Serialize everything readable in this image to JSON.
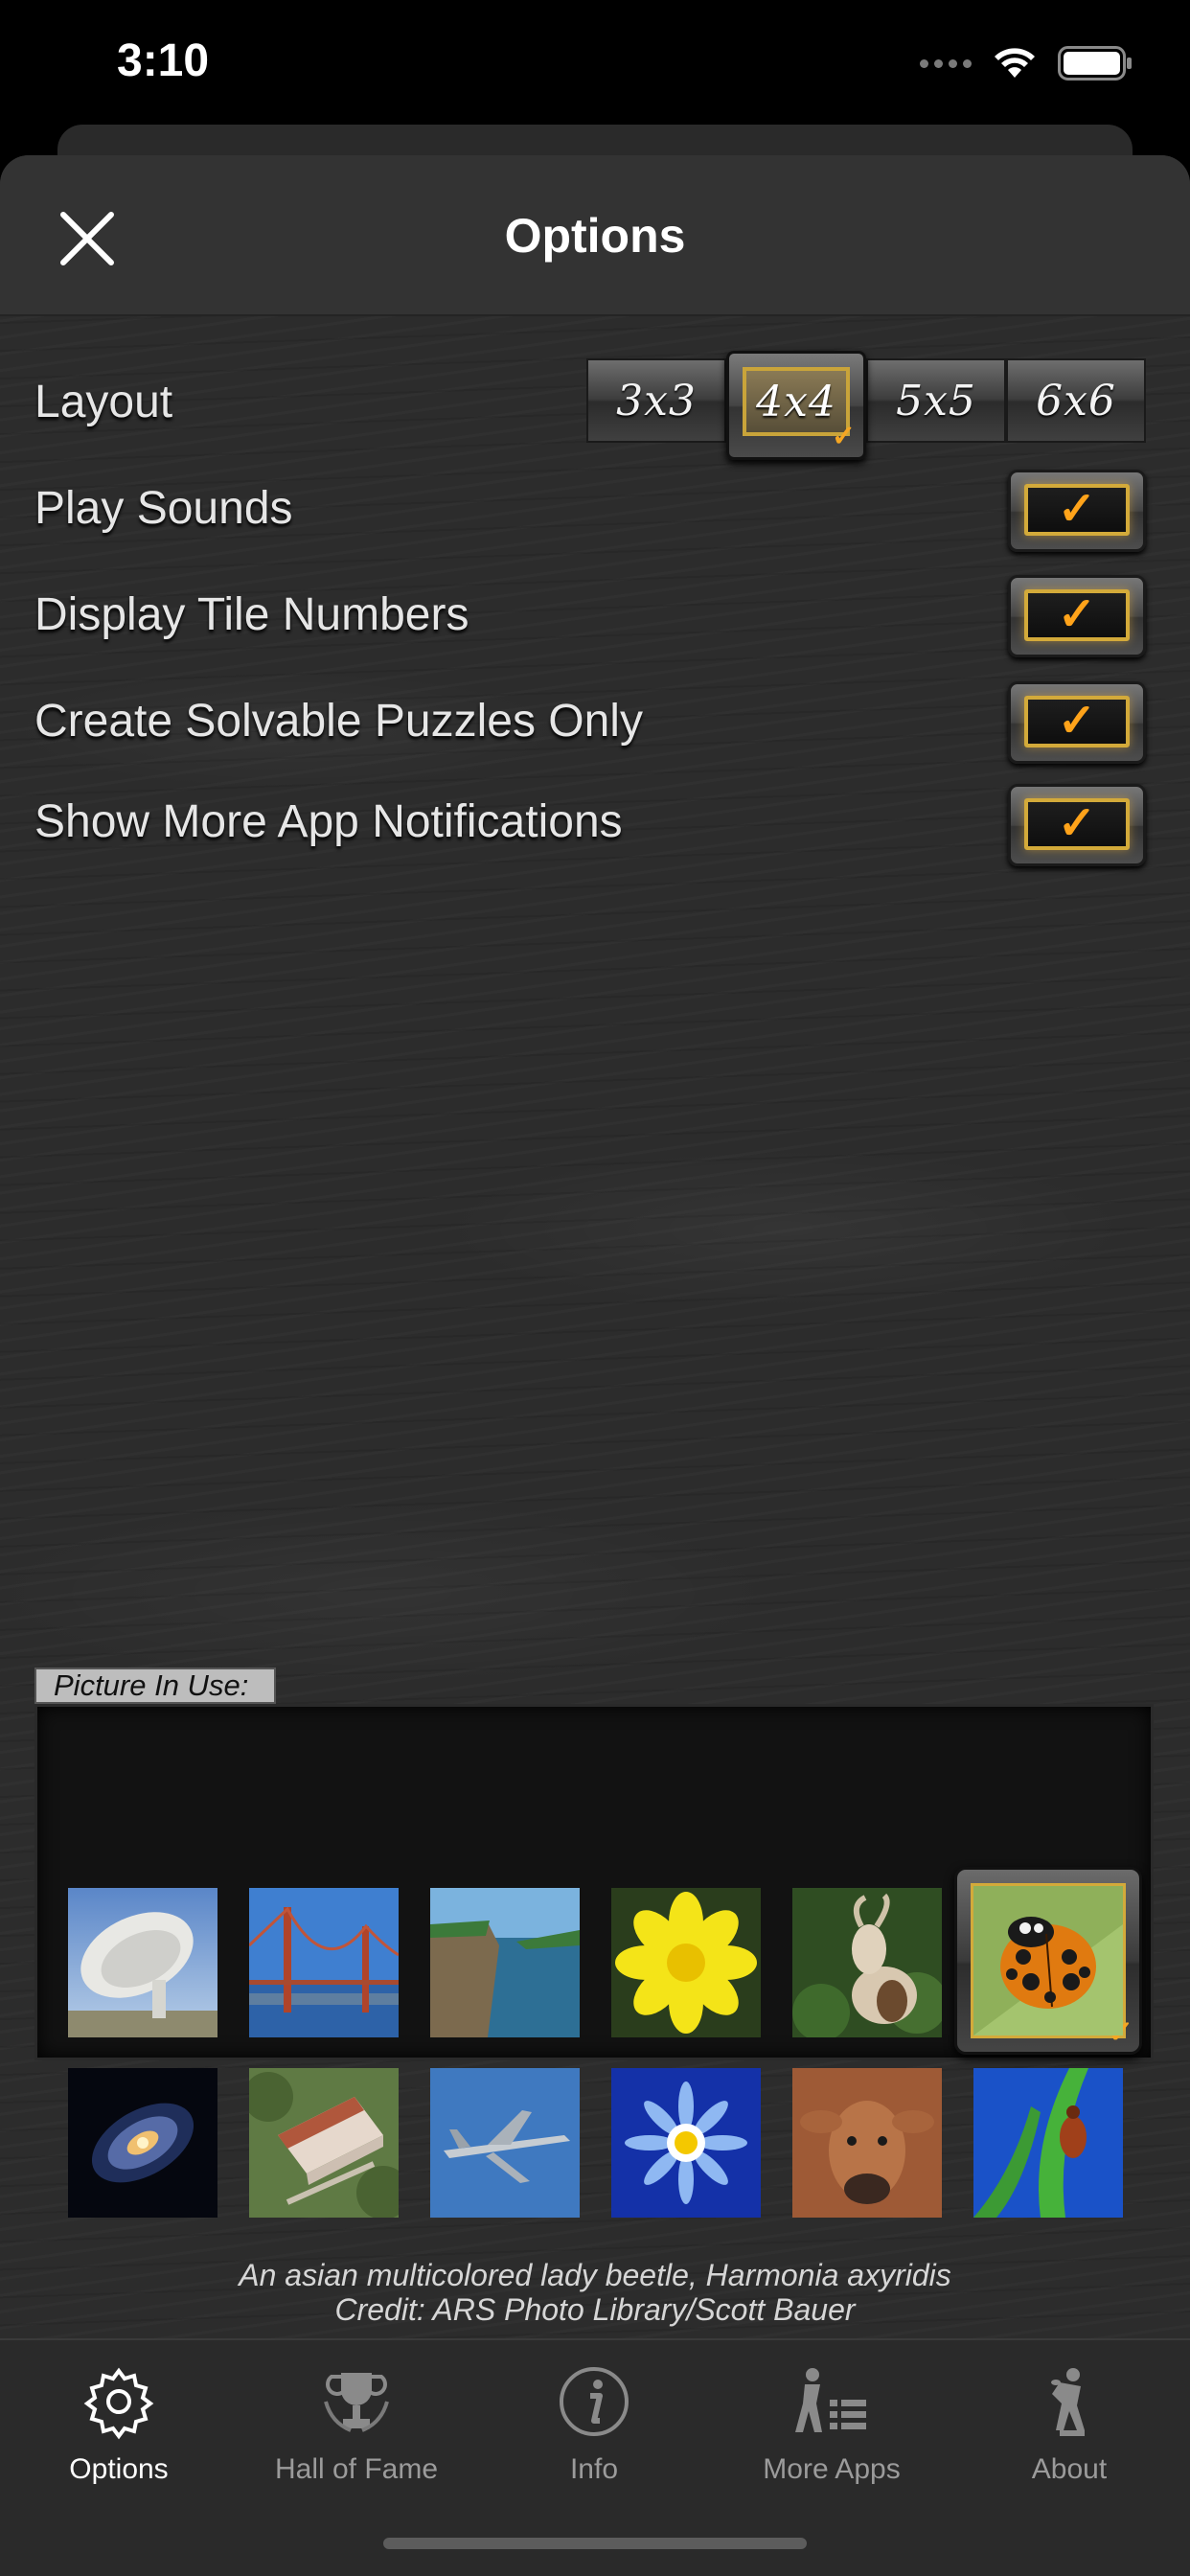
{
  "status_bar": {
    "time": "3:10"
  },
  "header": {
    "title": "Options"
  },
  "options": {
    "layout": {
      "label": "Layout",
      "choices": [
        "3x3",
        "4x4",
        "5x5",
        "6x6"
      ],
      "selected": "4x4"
    },
    "toggles": [
      {
        "label": "Play Sounds",
        "checked": true
      },
      {
        "label": "Display Tile Numbers",
        "checked": true
      },
      {
        "label": "Create Solvable Puzzles Only",
        "checked": true
      },
      {
        "label": "Show More App Notifications",
        "checked": true
      }
    ]
  },
  "picture": {
    "heading": "Picture In Use:",
    "selected_index": 5,
    "thumbnails": [
      "radio-telescope",
      "golden-gate-bridge",
      "coastal-cliffs",
      "yellow-flower",
      "goat",
      "ladybug",
      "spiral-galaxy",
      "castle",
      "fighter-jet",
      "blue-daisy",
      "cow",
      "beetle-on-leaf"
    ],
    "caption_line1": "An asian multicolored lady beetle, Harmonia axyridis",
    "caption_line2": "Credit: ARS Photo Library/Scott Bauer"
  },
  "tabs": [
    {
      "label": "Options",
      "icon": "gear-icon",
      "active": true
    },
    {
      "label": "Hall of Fame",
      "icon": "trophy-icon",
      "active": false
    },
    {
      "label": "Info",
      "icon": "info-icon",
      "active": false
    },
    {
      "label": "More Apps",
      "icon": "more-apps-icon",
      "active": false
    },
    {
      "label": "About",
      "icon": "discus-thrower-icon",
      "active": false
    }
  ],
  "colors": {
    "accent_gold": "#d3aa3a",
    "check_orange": "#ffa31a",
    "active_tab": "#ffffff",
    "inactive_tab": "#9b9b9b"
  }
}
